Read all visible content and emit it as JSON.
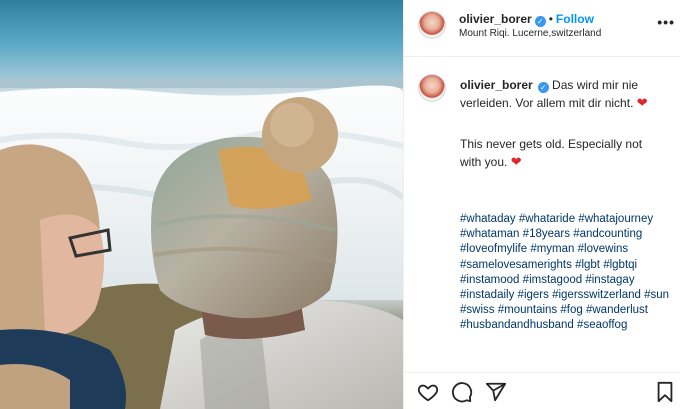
{
  "post": {
    "username": "olivier_borer",
    "follow_label": "Follow",
    "separator": "•",
    "location": "Mount Riqi. Lucerne,switzerland",
    "caption": "Das wird mir nie verleiden. Vor allem mit dir nicht.",
    "translation": "This never gets old. Especially not with you.",
    "hashtags": [
      "#whataday",
      "#whataride",
      "#whatajourney",
      "#whataman",
      "#18years",
      "#andcounting",
      "#loveofmylife",
      "#myman",
      "#lovewins",
      "#samelovesamerights",
      "#lgbt",
      "#lgbtqi",
      "#instamood",
      "#imstagood",
      "#instagay",
      "#instadaily",
      "#igers",
      "#igersswitzerland",
      "#sun",
      "#swiss",
      "#mountains",
      "#fog",
      "#wanderlust",
      "#husbandandhusband",
      "#seaoffog"
    ]
  },
  "icons": {
    "verified": "verified-badge-icon",
    "more": "more-options-icon",
    "like": "heart-icon",
    "comment": "comment-icon",
    "share": "share-icon",
    "save": "bookmark-icon",
    "caption_emoji": "red-heart-icon"
  },
  "colors": {
    "link": "#00376b",
    "follow": "#0095f6",
    "verified": "#3897f0",
    "heart": "#e0242c",
    "text": "#262626"
  }
}
